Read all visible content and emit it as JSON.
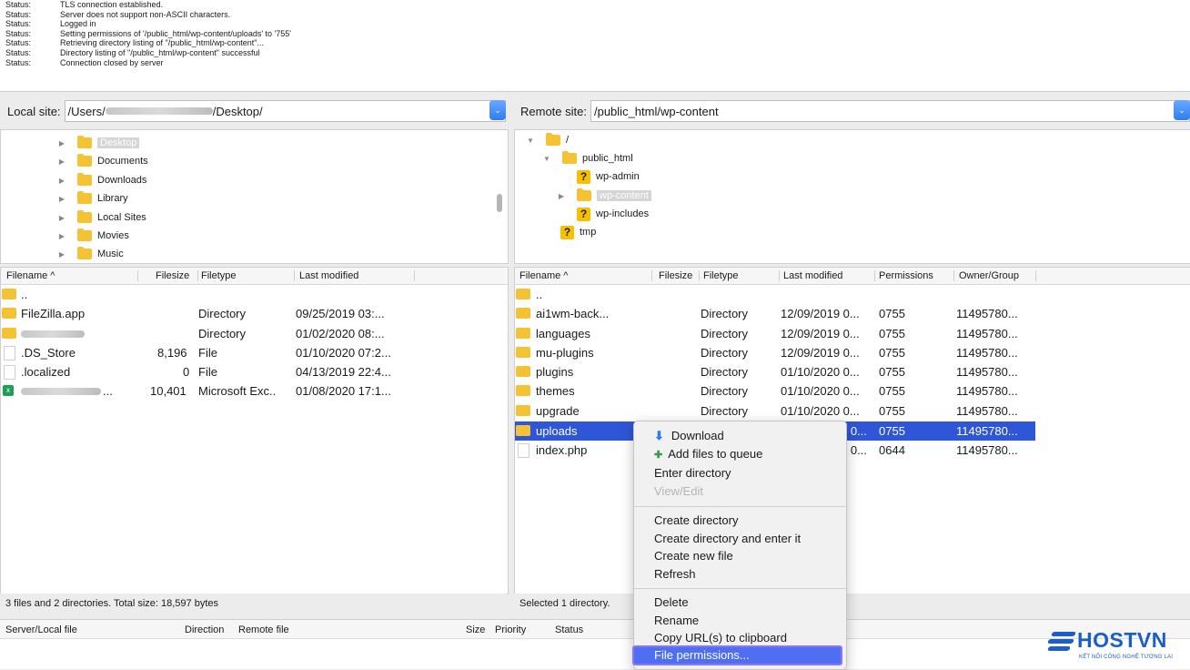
{
  "log": [
    {
      "k": "Status:",
      "v": "TLS connection established."
    },
    {
      "k": "Status:",
      "v": "Server does not support non-ASCII characters."
    },
    {
      "k": "Status:",
      "v": "Logged in"
    },
    {
      "k": "Status:",
      "v": "Setting permissions of '/public_html/wp-content/uploads' to '755'"
    },
    {
      "k": "Status:",
      "v": "Retrieving directory listing of \"/public_html/wp-content\"..."
    },
    {
      "k": "Status:",
      "v": "Directory listing of \"/public_html/wp-content\" successful"
    },
    {
      "k": "Status:",
      "v": "Connection closed by server"
    }
  ],
  "local": {
    "label": "Local site:",
    "path_prefix": "/Users/",
    "path_suffix": "/Desktop/",
    "tree": [
      "Desktop",
      "Documents",
      "Downloads",
      "Library",
      "Local Sites",
      "Movies",
      "Music"
    ],
    "headers": [
      "Filename ^",
      "Filesize",
      "Filetype",
      "Last modified"
    ],
    "files": [
      {
        "name": "..",
        "size": "",
        "type": "",
        "modified": ""
      },
      {
        "name": "FileZilla.app",
        "size": "",
        "type": "Directory",
        "modified": "09/25/2019 03:..."
      },
      {
        "name": "",
        "size": "",
        "type": "Directory",
        "modified": "01/02/2020 08:..."
      },
      {
        "name": ".DS_Store",
        "size": "8,196",
        "type": "File",
        "modified": "01/10/2020 07:2..."
      },
      {
        "name": ".localized",
        "size": "0",
        "type": "File",
        "modified": "04/13/2019 22:4..."
      },
      {
        "name": "",
        "size": "10,401",
        "type": "Microsoft Exc..",
        "modified": "01/08/2020 17:1..."
      }
    ],
    "status": "3 files and 2 directories. Total size: 18,597 bytes"
  },
  "remote": {
    "label": "Remote site:",
    "path": "/public_html/wp-content",
    "tree": [
      "/",
      "public_html",
      "wp-admin",
      "wp-content",
      "wp-includes",
      "tmp"
    ],
    "headers": [
      "Filename ^",
      "Filesize",
      "Filetype",
      "Last modified",
      "Permissions",
      "Owner/Group"
    ],
    "files": [
      {
        "name": "..",
        "type": "",
        "modified": "",
        "perm": "",
        "owner": ""
      },
      {
        "name": "ai1wm-back...",
        "type": "Directory",
        "modified": "12/09/2019 0...",
        "perm": "0755",
        "owner": "11495780..."
      },
      {
        "name": "languages",
        "type": "Directory",
        "modified": "12/09/2019 0...",
        "perm": "0755",
        "owner": "11495780..."
      },
      {
        "name": "mu-plugins",
        "type": "Directory",
        "modified": "12/09/2019 0...",
        "perm": "0755",
        "owner": "11495780..."
      },
      {
        "name": "plugins",
        "type": "Directory",
        "modified": "01/10/2020 0...",
        "perm": "0755",
        "owner": "11495780..."
      },
      {
        "name": "themes",
        "type": "Directory",
        "modified": "01/10/2020 0...",
        "perm": "0755",
        "owner": "11495780..."
      },
      {
        "name": "upgrade",
        "type": "Directory",
        "modified": "01/10/2020 0...",
        "perm": "0755",
        "owner": "11495780..."
      },
      {
        "name": "uploads",
        "type": "",
        "modified": "9 0...",
        "perm": "0755",
        "owner": "11495780..."
      },
      {
        "name": "index.php",
        "type": "",
        "modified": "9 0...",
        "perm": "0644",
        "owner": "11495780..."
      }
    ],
    "status": "Selected 1 directory."
  },
  "queue": {
    "headers": [
      "Server/Local file",
      "Direction",
      "Remote file",
      "Size",
      "Priority",
      "Status"
    ]
  },
  "menu": {
    "download": "Download",
    "add_queue": "Add files to queue",
    "enter_dir": "Enter directory",
    "view_edit": "View/Edit",
    "create_dir": "Create directory",
    "create_dir_enter": "Create directory and enter it",
    "create_file": "Create new file",
    "refresh": "Refresh",
    "delete": "Delete",
    "rename": "Rename",
    "copy_url": "Copy URL(s) to clipboard",
    "permissions": "File permissions..."
  },
  "logo": {
    "word": "HOSTVN",
    "tagline": "KẾT NỐI CÔNG NGHỆ TƯƠNG LAI"
  },
  "colors": {
    "selection": "#2f56d6",
    "accent": "#2f7cf2",
    "folder": "#f5c233",
    "logo": "#1a5fc7"
  }
}
